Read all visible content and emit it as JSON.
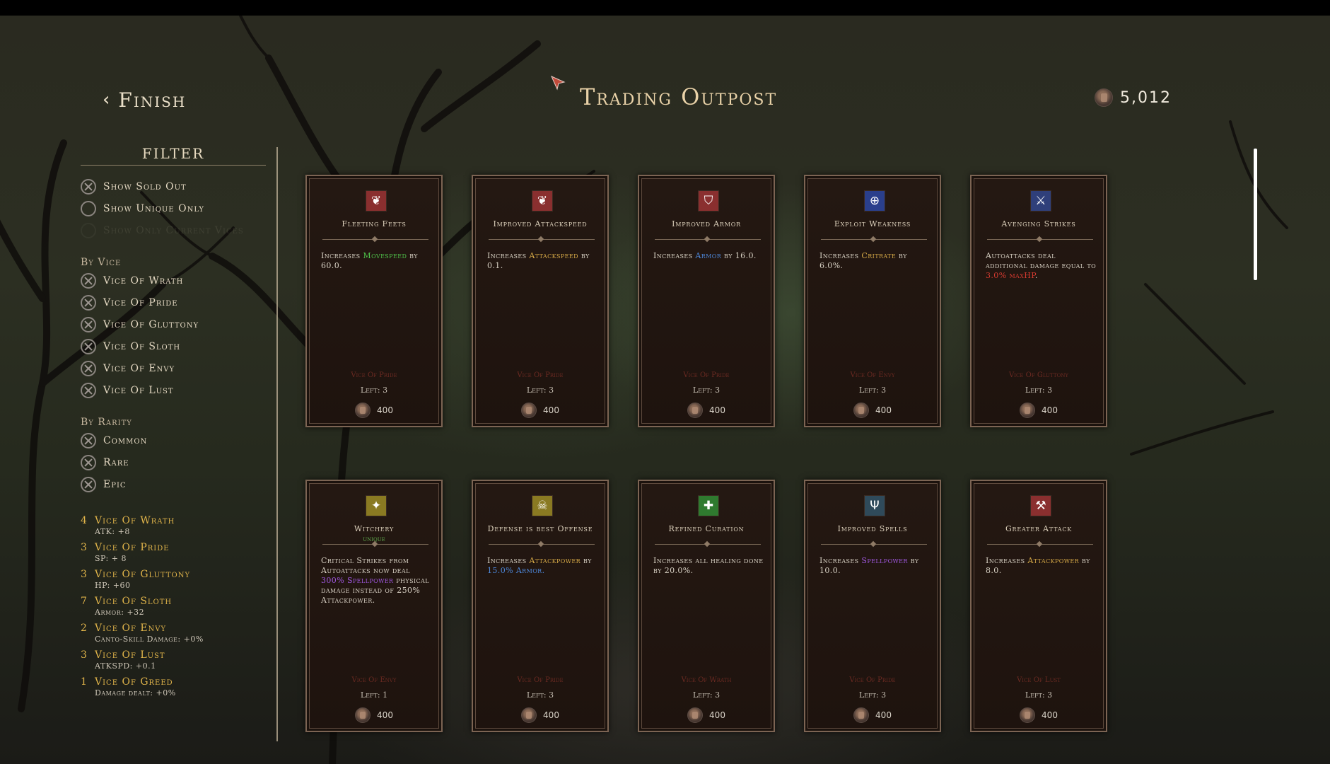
{
  "header": {
    "finish_label": "Finish",
    "title": "Trading Outpost",
    "currency": "5,012"
  },
  "filter": {
    "title": "FILTER",
    "options": [
      "Show Sold Out",
      "Show Unique Only",
      "Show Only Current Vices"
    ],
    "by_vice_label": "By Vice",
    "vices": [
      "Vice Of Wrath",
      "Vice Of Pride",
      "Vice Of Gluttony",
      "Vice Of Sloth",
      "Vice Of Envy",
      "Vice Of Lust"
    ],
    "by_rarity_label": "By Rarity",
    "rarities": [
      "Common",
      "Rare",
      "Epic"
    ]
  },
  "bonuses": [
    {
      "count": "4",
      "name": "Vice Of Wrath",
      "stat": "ATK: +8"
    },
    {
      "count": "3",
      "name": "Vice Of Pride",
      "stat": "SP: + 8"
    },
    {
      "count": "3",
      "name": "Vice Of Gluttony",
      "stat": "HP: +60"
    },
    {
      "count": "7",
      "name": "Vice Of Sloth",
      "stat": "Armor: +32"
    },
    {
      "count": "2",
      "name": "Vice Of Envy",
      "stat": "Canto-Skill Damage: +0%"
    },
    {
      "count": "3",
      "name": "Vice Of Lust",
      "stat": "ATKSPD: +0.1"
    },
    {
      "count": "1",
      "name": "Vice Of Greed",
      "stat": "Damage dealt: +0%"
    }
  ],
  "cards": [
    {
      "name": "Fleeting Feets",
      "tag": "",
      "desc_pre": "Increases ",
      "hl": "Movespeed",
      "hl_color": "#4fc24a",
      "desc_post": " by 60.0.",
      "desc_extra": "",
      "extra_color": "",
      "vice": "Vice Of Pride",
      "left": "Left: 3",
      "price": "400",
      "icon_color": "#8a2f2f",
      "icon_glyph": "❦"
    },
    {
      "name": "Improved Attackspeed",
      "tag": "",
      "desc_pre": "Increases ",
      "hl": "Attackspeed",
      "hl_color": "#d6a947",
      "desc_post": " by 0.1.",
      "desc_extra": "",
      "extra_color": "",
      "vice": "Vice Of Pride",
      "left": "Left: 3",
      "price": "400",
      "icon_color": "#8a2f2f",
      "icon_glyph": "❦"
    },
    {
      "name": "Improved Armor",
      "tag": "",
      "desc_pre": "Increases ",
      "hl": "Armor",
      "hl_color": "#4d86d8",
      "desc_post": " by 16.0.",
      "desc_extra": "",
      "extra_color": "",
      "vice": "Vice Of Pride",
      "left": "Left: 3",
      "price": "400",
      "icon_color": "#8a2f2f",
      "icon_glyph": "⛉"
    },
    {
      "name": "Exploit Weakness",
      "tag": "",
      "desc_pre": "Increases ",
      "hl": "Critrate",
      "hl_color": "#d6a947",
      "desc_post": " by 6.0%.",
      "desc_extra": "",
      "extra_color": "",
      "vice": "Vice Of Envy",
      "left": "Left: 3",
      "price": "400",
      "icon_color": "#2a3f8c",
      "icon_glyph": "⊕"
    },
    {
      "name": "Avenging Strikes",
      "tag": "",
      "desc_pre": "Autoattacks deal additional damage equal to ",
      "hl": "3.0% maxHP",
      "hl_color": "#d43a2f",
      "desc_post": ".",
      "desc_extra": "",
      "extra_color": "",
      "vice": "Vice Of Gluttony",
      "left": "Left: 3",
      "price": "400",
      "icon_color": "#2f3f7a",
      "icon_glyph": "⚔"
    },
    {
      "name": "Witchery",
      "tag": "unique",
      "desc_pre": "Critical Strikes from Autoattacks now deal ",
      "hl": "300% Spellpower",
      "hl_color": "#a058e0",
      "desc_post": " physical damage instead of 250% Attackpower.",
      "desc_extra": "",
      "extra_color": "",
      "vice": "Vice Of Envy",
      "left": "Left: 1",
      "price": "400",
      "icon_color": "#8a7a22",
      "icon_glyph": "✦"
    },
    {
      "name": "Defense is best Offense",
      "tag": "",
      "desc_pre": "Increases ",
      "hl": "Attackpower",
      "hl_color": "#d6a947",
      "desc_post": " by ",
      "desc_extra": "15.0% Armor.",
      "extra_color": "#4d86d8",
      "vice": "Vice Of Pride",
      "left": "Left: 3",
      "price": "400",
      "icon_color": "#8a7a22",
      "icon_glyph": "☠"
    },
    {
      "name": "Refined Curation",
      "tag": "",
      "desc_pre": "Increases all healing done by 20.0%.",
      "hl": "",
      "hl_color": "",
      "desc_post": "",
      "desc_extra": "",
      "extra_color": "",
      "vice": "Vice Of Wrath",
      "left": "Left: 3",
      "price": "400",
      "icon_color": "#2f7a2f",
      "icon_glyph": "✚"
    },
    {
      "name": "Improved Spells",
      "tag": "",
      "desc_pre": "Increases ",
      "hl": "Spellpower",
      "hl_color": "#a058e0",
      "desc_post": " by 10.0.",
      "desc_extra": "",
      "extra_color": "",
      "vice": "Vice Of Pride",
      "left": "Left: 3",
      "price": "400",
      "icon_color": "#2f4a5a",
      "icon_glyph": "Ψ"
    },
    {
      "name": "Greater Attack",
      "tag": "",
      "desc_pre": "Increases ",
      "hl": "Attackpower",
      "hl_color": "#d6a947",
      "desc_post": " by 8.0.",
      "desc_extra": "",
      "extra_color": "",
      "vice": "Vice Of Lust",
      "left": "Left: 3",
      "price": "400",
      "icon_color": "#8a2f2f",
      "icon_glyph": "⚒"
    }
  ]
}
